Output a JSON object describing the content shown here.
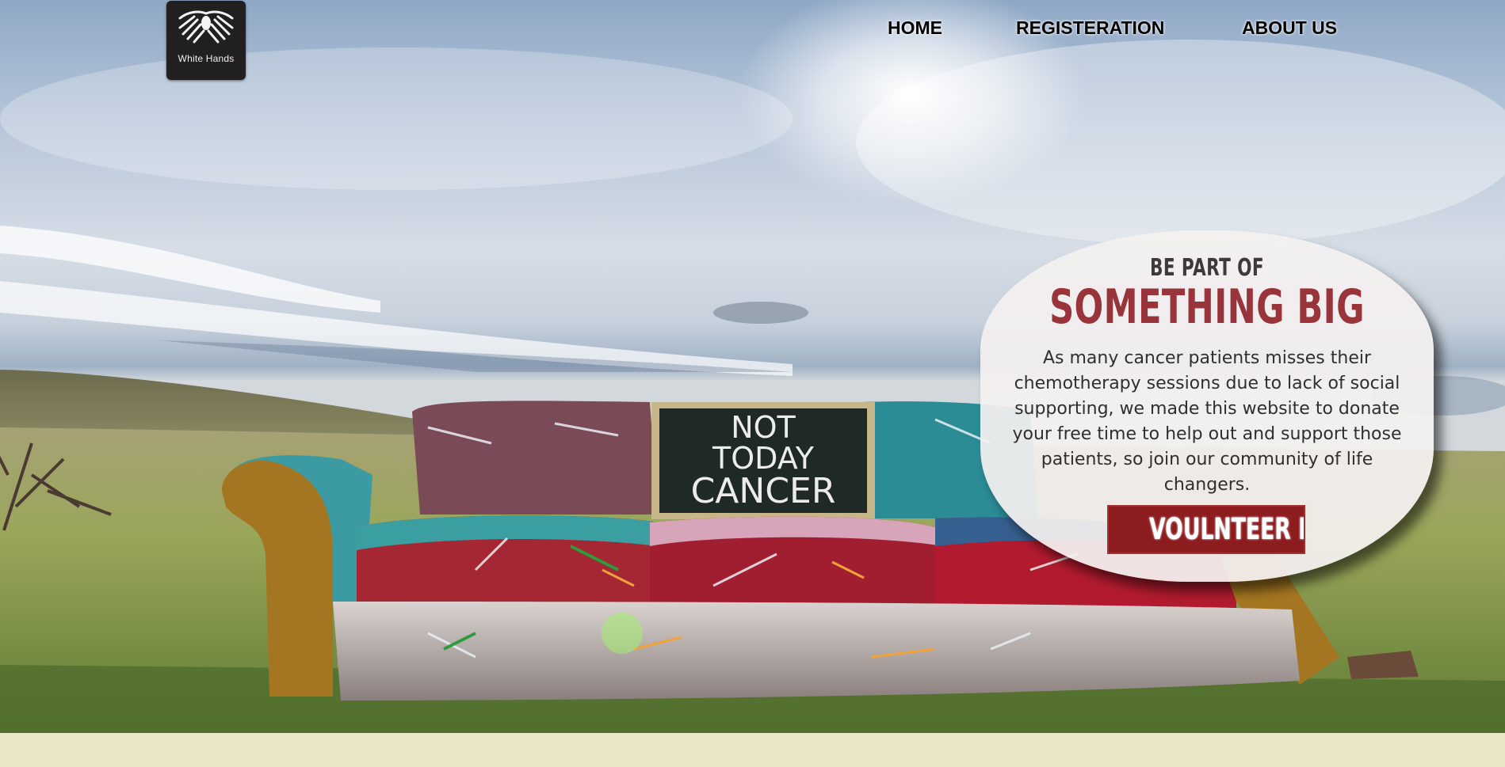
{
  "logo": {
    "icon": "hands-icon",
    "name": "White Hands"
  },
  "nav": {
    "home": "HOME",
    "registration": "REGISTERATION",
    "about": "ABOUT US"
  },
  "hero": {
    "sign_line_1": "NOT",
    "sign_line_2": "TODAY",
    "sign_line_3": "CANCER"
  },
  "callout": {
    "kicker": "BE PART OF",
    "headline": "SOMETHING BIG",
    "body": "As many cancer patients misses their chemotherapy sessions due to lack of social supporting, we made this website to donate your free time to help out and support those patients, so join our community of life changers.",
    "button": "VOULNTEER NOW"
  },
  "colors": {
    "accent": "#98343a",
    "button": "#8d1c1f",
    "footer": "#ece6c9"
  }
}
